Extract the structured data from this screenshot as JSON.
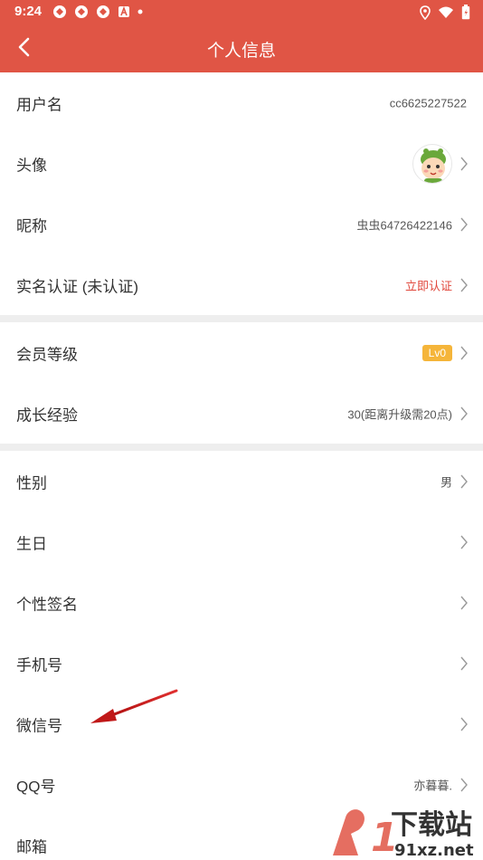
{
  "status_bar": {
    "time": "9:24"
  },
  "header": {
    "title": "个人信息"
  },
  "rows": {
    "username": {
      "label": "用户名",
      "value": "cc6625227522"
    },
    "avatar": {
      "label": "头像"
    },
    "nickname": {
      "label": "昵称",
      "value": "虫虫64726422146"
    },
    "realname": {
      "label": "实名认证 (未认证)",
      "value": "立即认证"
    },
    "member_level": {
      "label": "会员等级",
      "value": "Lv0"
    },
    "growth": {
      "label": "成长经验",
      "value": "30(距离升级需20点)"
    },
    "gender": {
      "label": "性别",
      "value": "男"
    },
    "birthday": {
      "label": "生日"
    },
    "signature": {
      "label": "个性签名"
    },
    "phone": {
      "label": "手机号"
    },
    "wechat": {
      "label": "微信号"
    },
    "qq": {
      "label": "QQ号",
      "value": "亦暮暮."
    },
    "email": {
      "label": "邮箱"
    }
  },
  "watermark": {
    "text_top": "下载站",
    "text_bottom": "91xz.net"
  },
  "colors": {
    "header": "#e05545",
    "accent_red": "#e0463a",
    "badge": "#f5b53a",
    "separator": "#eeeeee"
  },
  "icons": [
    "back-arrow-icon",
    "chevron-right-icon",
    "location-icon",
    "wifi-icon",
    "battery-icon"
  ]
}
